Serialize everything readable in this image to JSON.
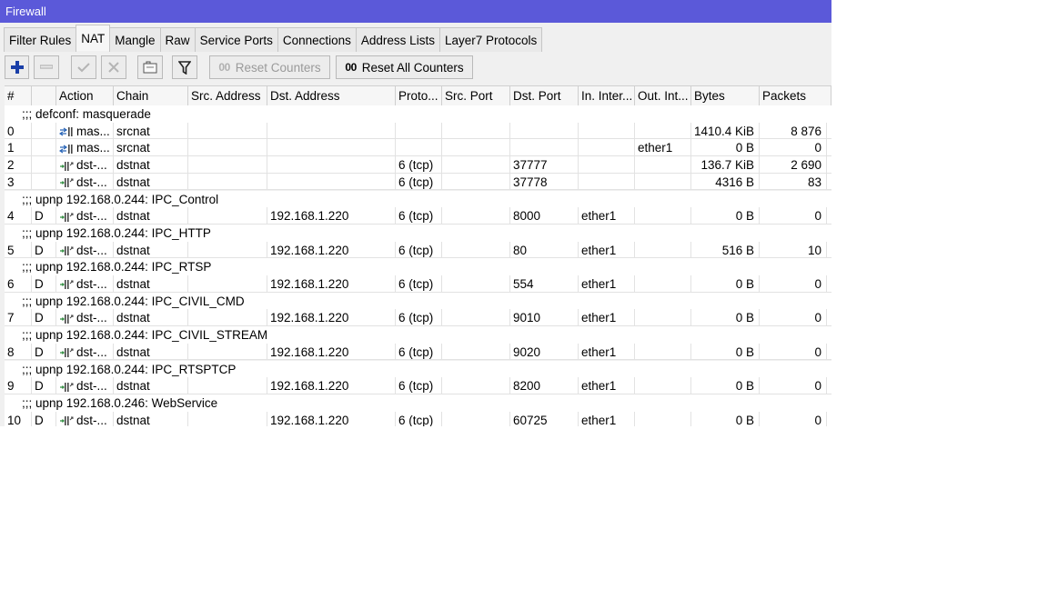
{
  "window": {
    "title": "Firewall"
  },
  "tabs": [
    "Filter Rules",
    "NAT",
    "Mangle",
    "Raw",
    "Service Ports",
    "Connections",
    "Address Lists",
    "Layer7 Protocols"
  ],
  "active_tab": "NAT",
  "toolbar": {
    "reset_counters": "Reset Counters",
    "reset_all_counters": "Reset All Counters",
    "oo_glyph": "00"
  },
  "columns": [
    "#",
    "",
    "Action",
    "Chain",
    "Src. Address",
    "Dst. Address",
    "Proto...",
    "Src. Port",
    "Dst. Port",
    "In. Inter...",
    "Out. Int...",
    "Bytes",
    "Packets"
  ],
  "rows": [
    {
      "type": "comment",
      "text": ";;; defconf: masquerade"
    },
    {
      "type": "rule",
      "num": "0",
      "flag": "",
      "action": "mas...",
      "icon": "masquerade-icon",
      "chain": "srcnat",
      "src_address": "",
      "dst_address": "",
      "protocol": "",
      "src_port": "",
      "dst_port": "",
      "in_interface": "",
      "out_interface": "",
      "bytes": "1410.4 KiB",
      "packets": "8 876"
    },
    {
      "type": "rule",
      "num": "1",
      "flag": "",
      "action": "mas...",
      "icon": "masquerade-icon",
      "chain": "srcnat",
      "src_address": "",
      "dst_address": "",
      "protocol": "",
      "src_port": "",
      "dst_port": "",
      "in_interface": "",
      "out_interface": "ether1",
      "bytes": "0 B",
      "packets": "0"
    },
    {
      "type": "rule",
      "num": "2",
      "flag": "",
      "action": "dst-...",
      "icon": "dst-nat-icon",
      "chain": "dstnat",
      "src_address": "",
      "dst_address": "",
      "protocol": "6 (tcp)",
      "src_port": "",
      "dst_port": "37777",
      "in_interface": "",
      "out_interface": "",
      "bytes": "136.7 KiB",
      "packets": "2 690"
    },
    {
      "type": "rule",
      "num": "3",
      "flag": "",
      "action": "dst-...",
      "icon": "dst-nat-icon",
      "chain": "dstnat",
      "src_address": "",
      "dst_address": "",
      "protocol": "6 (tcp)",
      "src_port": "",
      "dst_port": "37778",
      "in_interface": "",
      "out_interface": "",
      "bytes": "4316 B",
      "packets": "83"
    },
    {
      "type": "comment",
      "text": ";;; upnp 192.168.0.244: IPC_Control"
    },
    {
      "type": "rule",
      "num": "4",
      "flag": "D",
      "action": "dst-...",
      "icon": "dst-nat-icon",
      "chain": "dstnat",
      "src_address": "",
      "dst_address": "192.168.1.220",
      "protocol": "6 (tcp)",
      "src_port": "",
      "dst_port": "8000",
      "in_interface": "ether1",
      "out_interface": "",
      "bytes": "0 B",
      "packets": "0"
    },
    {
      "type": "comment",
      "text": ";;; upnp 192.168.0.244: IPC_HTTP"
    },
    {
      "type": "rule",
      "num": "5",
      "flag": "D",
      "action": "dst-...",
      "icon": "dst-nat-icon",
      "chain": "dstnat",
      "src_address": "",
      "dst_address": "192.168.1.220",
      "protocol": "6 (tcp)",
      "src_port": "",
      "dst_port": "80",
      "in_interface": "ether1",
      "out_interface": "",
      "bytes": "516 B",
      "packets": "10"
    },
    {
      "type": "comment",
      "text": ";;; upnp 192.168.0.244: IPC_RTSP"
    },
    {
      "type": "rule",
      "num": "6",
      "flag": "D",
      "action": "dst-...",
      "icon": "dst-nat-icon",
      "chain": "dstnat",
      "src_address": "",
      "dst_address": "192.168.1.220",
      "protocol": "6 (tcp)",
      "src_port": "",
      "dst_port": "554",
      "in_interface": "ether1",
      "out_interface": "",
      "bytes": "0 B",
      "packets": "0"
    },
    {
      "type": "comment",
      "text": ";;; upnp 192.168.0.244: IPC_CIVIL_CMD"
    },
    {
      "type": "rule",
      "num": "7",
      "flag": "D",
      "action": "dst-...",
      "icon": "dst-nat-icon",
      "chain": "dstnat",
      "src_address": "",
      "dst_address": "192.168.1.220",
      "protocol": "6 (tcp)",
      "src_port": "",
      "dst_port": "9010",
      "in_interface": "ether1",
      "out_interface": "",
      "bytes": "0 B",
      "packets": "0"
    },
    {
      "type": "comment",
      "text": ";;; upnp 192.168.0.244: IPC_CIVIL_STREAM"
    },
    {
      "type": "rule",
      "num": "8",
      "flag": "D",
      "action": "dst-...",
      "icon": "dst-nat-icon",
      "chain": "dstnat",
      "src_address": "",
      "dst_address": "192.168.1.220",
      "protocol": "6 (tcp)",
      "src_port": "",
      "dst_port": "9020",
      "in_interface": "ether1",
      "out_interface": "",
      "bytes": "0 B",
      "packets": "0"
    },
    {
      "type": "comment",
      "text": ";;; upnp 192.168.0.244: IPC_RTSPTCP"
    },
    {
      "type": "rule",
      "num": "9",
      "flag": "D",
      "action": "dst-...",
      "icon": "dst-nat-icon",
      "chain": "dstnat",
      "src_address": "",
      "dst_address": "192.168.1.220",
      "protocol": "6 (tcp)",
      "src_port": "",
      "dst_port": "8200",
      "in_interface": "ether1",
      "out_interface": "",
      "bytes": "0 B",
      "packets": "0"
    },
    {
      "type": "comment",
      "text": ";;; upnp 192.168.0.246: WebService"
    },
    {
      "type": "rule",
      "num": "10",
      "flag": "D",
      "action": "dst-...",
      "icon": "dst-nat-icon",
      "chain": "dstnat",
      "src_address": "",
      "dst_address": "192.168.1.220",
      "protocol": "6 (tcp)",
      "src_port": "",
      "dst_port": "60725",
      "in_interface": "ether1",
      "out_interface": "",
      "bytes": "0 B",
      "packets": "0"
    }
  ]
}
